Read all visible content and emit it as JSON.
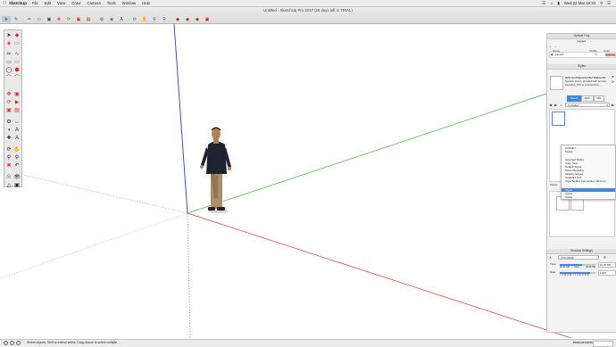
{
  "menubar": {
    "app_name": "SketchUp",
    "menus": [
      "File",
      "Edit",
      "View",
      "Draw",
      "Camera",
      "Tools",
      "Window",
      "Help"
    ],
    "datetime": "Wed 22 Mar  16:34"
  },
  "window": {
    "title": "Untitled - SketchUp Pro 2017 (28 days left in TRIAL)"
  },
  "panel": {
    "section_layers": "Default Tray",
    "layers_title": "Layers",
    "layers_headers": {
      "name": "Name",
      "visible": "Visible",
      "color": "Color"
    },
    "layers": [
      {
        "name": "Layer0",
        "color": "#e87a72"
      }
    ],
    "section_styles": "Styles",
    "style_name": "ACE Architectural Set Elements",
    "style_desc": "Section views, shaded with texture, beautiful, PPI to Architecture...",
    "tabs": [
      "Select",
      "Edit",
      "Mix"
    ],
    "select_value": "In Model",
    "mix_label": "Select",
    "shadow_section": "Shadow Settings",
    "utc": "UTC-08:00",
    "time_label": "Time",
    "time_start": "06:45 AM",
    "time_noon": "Noon",
    "time_end": "04:46 PM",
    "time_value": "01:30 PM",
    "time_fraction": 0.62,
    "date_label": "Date",
    "date_months": "J F M A M J J A S O N D",
    "date_value": "11/08",
    "date_fraction": 0.84
  },
  "dropdown": {
    "items": [
      "In Model",
      "Styles",
      "Assorted Styles",
      "Color Sets",
      "Default Styles",
      "Photo Modeling",
      "Sketchy Edges",
      "Straight Lines",
      "Style Builder Competition Winners",
      "",
      "Styles",
      "Styles",
      "Styles"
    ],
    "selected_index": 10
  },
  "status": {
    "message": "Select objects. Shift to extend select. Drag mouse to select multiple.",
    "measurements_label": "Measurements"
  },
  "colors": {
    "axis_red": "#d93a3a",
    "axis_green": "#4cb04c",
    "axis_blue": "#2d3fd6",
    "accent": "#3d86f0"
  }
}
